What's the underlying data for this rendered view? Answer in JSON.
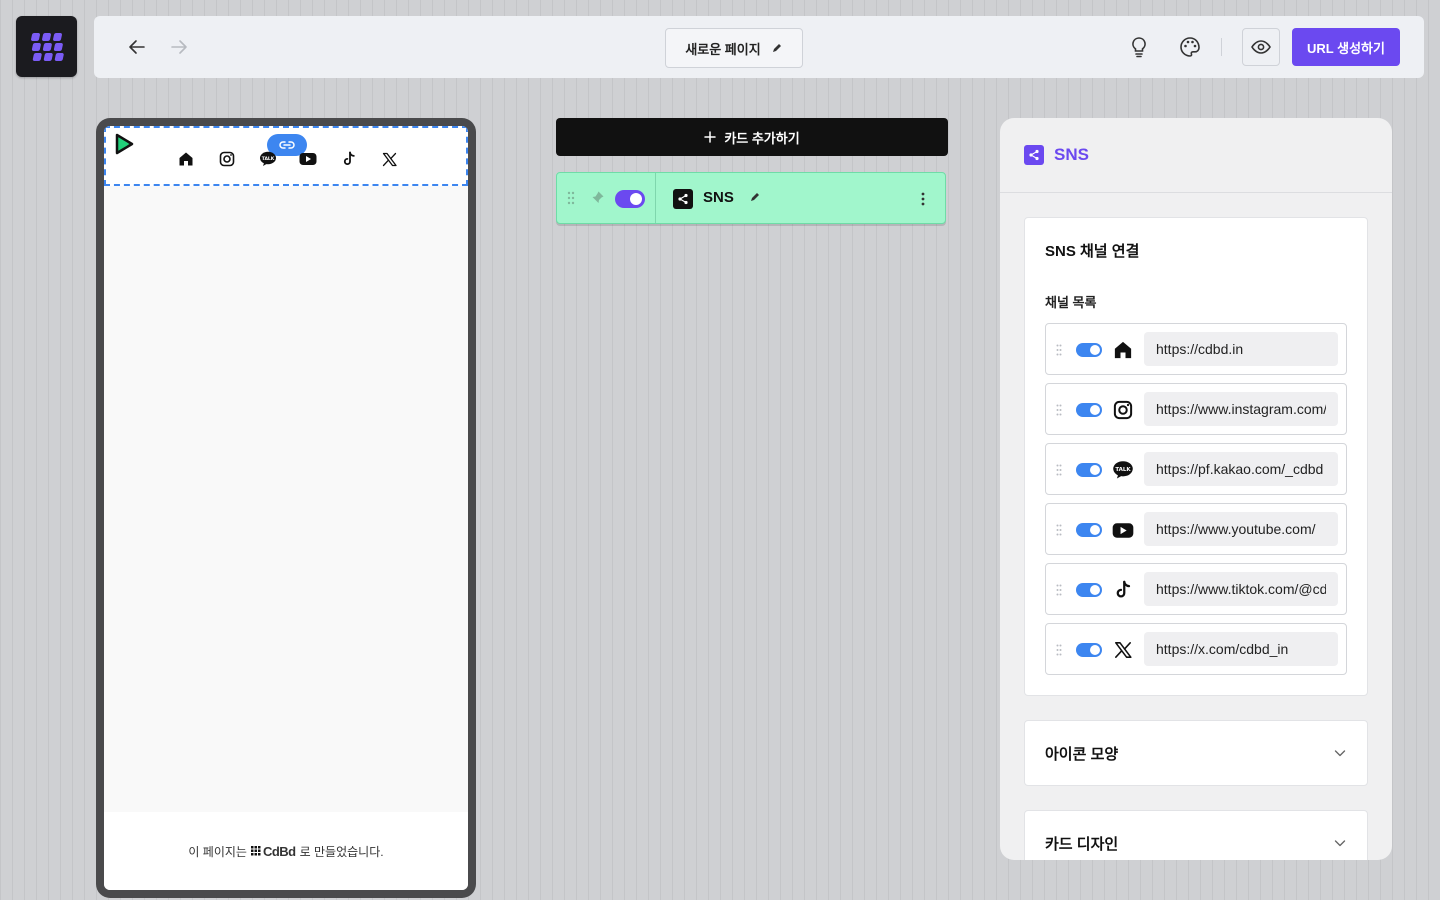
{
  "header": {
    "page_title": "새로운 페이지",
    "url_button": "URL 생성하기"
  },
  "phone": {
    "footer_prefix": "이 페이지는",
    "footer_brand": "CdBd",
    "footer_suffix": "로 만들었습니다."
  },
  "editor": {
    "add_card_label": "카드 추가하기",
    "card": {
      "title": "SNS",
      "enabled": true
    }
  },
  "panel": {
    "title": "SNS",
    "connect_title": "SNS 채널 연결",
    "channel_list_label": "채널 목록",
    "channels": [
      {
        "icon": "home-icon",
        "enabled": true,
        "url": "https://cdbd.in"
      },
      {
        "icon": "instagram-icon",
        "enabled": true,
        "url": "https://www.instagram.com/cdbd"
      },
      {
        "icon": "kakaotalk-icon",
        "enabled": true,
        "url": "https://pf.kakao.com/_cdbd"
      },
      {
        "icon": "youtube-icon",
        "enabled": true,
        "url": "https://www.youtube.com/"
      },
      {
        "icon": "tiktok-icon",
        "enabled": true,
        "url": "https://www.tiktok.com/@cdbd"
      },
      {
        "icon": "x-icon",
        "enabled": true,
        "url": "https://x.com/cdbd_in"
      }
    ],
    "icon_shape_label": "아이콘 모양",
    "card_design_label": "카드 디자인"
  },
  "colors": {
    "accent": "#6b49f0",
    "toggle_blue": "#3d86f0",
    "card_green": "#a1f6cc"
  }
}
